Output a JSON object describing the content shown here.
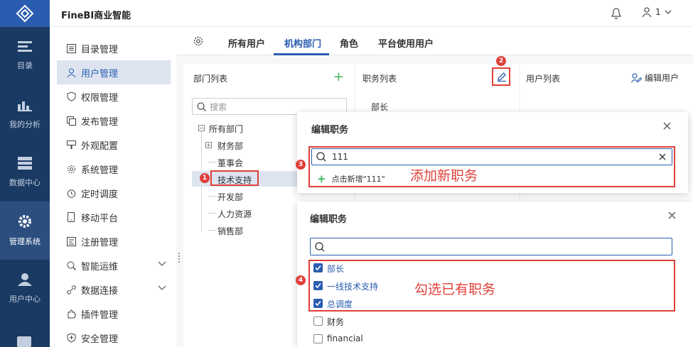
{
  "app": {
    "title": "FineBI商业智能",
    "user_name": "1",
    "bell_icon": "bell-icon"
  },
  "rail": {
    "items": [
      {
        "label": "目录",
        "icon": "catalog-icon"
      },
      {
        "label": "我的分析",
        "icon": "analysis-icon"
      },
      {
        "label": "数据中心",
        "icon": "data-center-icon"
      },
      {
        "label": "管理系统",
        "icon": "gear-icon"
      },
      {
        "label": "用户中心",
        "icon": "user-center-icon"
      }
    ]
  },
  "submenu": {
    "items": [
      {
        "label": "目录管理",
        "icon": "list-icon"
      },
      {
        "label": "用户管理",
        "icon": "user-icon"
      },
      {
        "label": "权限管理",
        "icon": "shield-icon"
      },
      {
        "label": "发布管理",
        "icon": "publish-icon"
      },
      {
        "label": "外观配置",
        "icon": "appearance-icon"
      },
      {
        "label": "系统管理",
        "icon": "gear-icon"
      },
      {
        "label": "定时调度",
        "icon": "timer-icon"
      },
      {
        "label": "移动平台",
        "icon": "mobile-icon"
      },
      {
        "label": "注册管理",
        "icon": "register-icon"
      },
      {
        "label": "智能运维",
        "icon": "ops-icon"
      },
      {
        "label": "数据连接",
        "icon": "link-icon"
      },
      {
        "label": "插件管理",
        "icon": "plugin-icon"
      },
      {
        "label": "安全管理",
        "icon": "security-icon"
      }
    ]
  },
  "tabs": [
    "所有用户",
    "机构部门",
    "角色",
    "平台使用用户"
  ],
  "dept_panel": {
    "title": "部门列表",
    "search_placeholder": "搜索",
    "tree": [
      "所有部门",
      "财务部",
      "董事会",
      "技术支持",
      "开发部",
      "人力资源",
      "销售部"
    ]
  },
  "position_panel": {
    "title": "职务列表",
    "first_item": "部长"
  },
  "user_panel": {
    "title": "用户列表",
    "edit_label": "编辑用户"
  },
  "badges": [
    "1",
    "2",
    "3",
    "4"
  ],
  "modal1": {
    "title": "编辑职务",
    "search_value": "111",
    "add_new_label": "点击新增\"111\"",
    "annotation": "添加新职务"
  },
  "modal2": {
    "title": "编辑职务",
    "annotation": "勾选已有职务",
    "options": [
      {
        "label": "部长",
        "checked": true
      },
      {
        "label": "一线技术支持",
        "checked": true
      },
      {
        "label": "总调度",
        "checked": true
      },
      {
        "label": "财务",
        "checked": false
      },
      {
        "label": "financial",
        "checked": false
      }
    ]
  },
  "colors": {
    "accent": "#2a5db0",
    "rail": "#1a3a63",
    "annotation_red": "#e0403a",
    "add_green": "#3bb55b"
  }
}
